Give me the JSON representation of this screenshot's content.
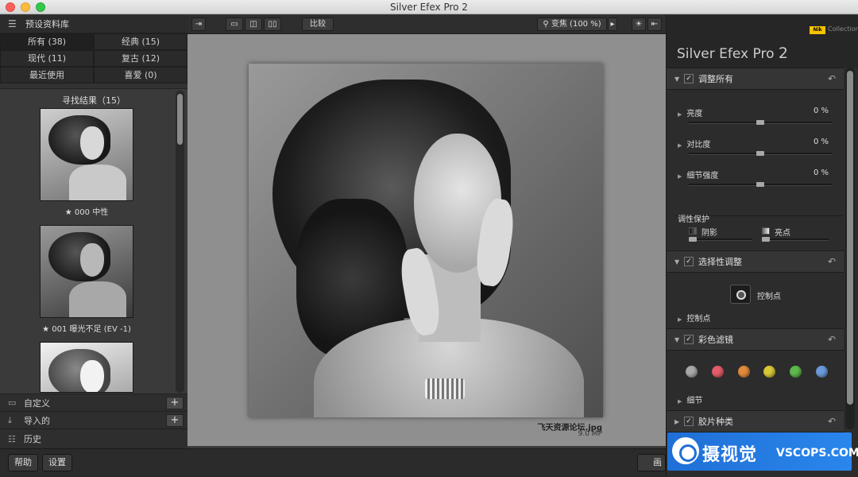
{
  "window": {
    "title": "Silver Efex Pro 2"
  },
  "left_panel": {
    "header": "预设资料库",
    "tabs": [
      "所有 (38)",
      "经典 (15)",
      "现代 (11)",
      "复古 (12)",
      "最近使用",
      "喜爱 (0)"
    ],
    "results_title": "寻找结果（15）",
    "presets": [
      {
        "label": "★ 000 中性"
      },
      {
        "label": "★ 001 曝光不足 (EV -1)"
      }
    ],
    "sections": [
      {
        "label": "自定义",
        "icon": "folder-icon",
        "plus": "+"
      },
      {
        "label": "导入的",
        "icon": "download-icon",
        "plus": "+"
      },
      {
        "label": "历史",
        "icon": "history-icon"
      }
    ]
  },
  "toolbar": {
    "compare_label": "比较",
    "zoom_label": "变焦 (100 %)"
  },
  "canvas": {
    "file_name": "飞天资源论坛.jpg",
    "file_size": "9.0 MP"
  },
  "bottom": {
    "help_label": "帮助",
    "settings_label": "设置",
    "right_label": "画"
  },
  "right_panel": {
    "brand": "Nik",
    "collection": "Collection",
    "product": "Silver Efex Pro",
    "product_version": "2",
    "global_section": "调整所有",
    "brightness": {
      "label": "亮度",
      "value": "0 %",
      "level": 0.5
    },
    "contrast": {
      "label": "对比度",
      "value": "0 %",
      "level": 0.5
    },
    "structure": {
      "label": "细节强度",
      "value": "0 %",
      "level": 0.5
    },
    "tonality_protection": "调性保护",
    "shadows_label": "阴影",
    "highlights_label": "亮点",
    "selective_section": "选择性调整",
    "control_point_button": "控制点",
    "control_points_sub": "控制点",
    "color_filter_section": "彩色滤镜",
    "filter_colors": [
      "#a8a8a8",
      "#e45c6a",
      "#e08a3a",
      "#d8c838",
      "#5cb84c",
      "#6a9ad8"
    ],
    "details_sub": "细节",
    "film_section": "胶片种类"
  },
  "watermark": {
    "cn": "摄视觉",
    "en": "VSCOPS.COM"
  }
}
